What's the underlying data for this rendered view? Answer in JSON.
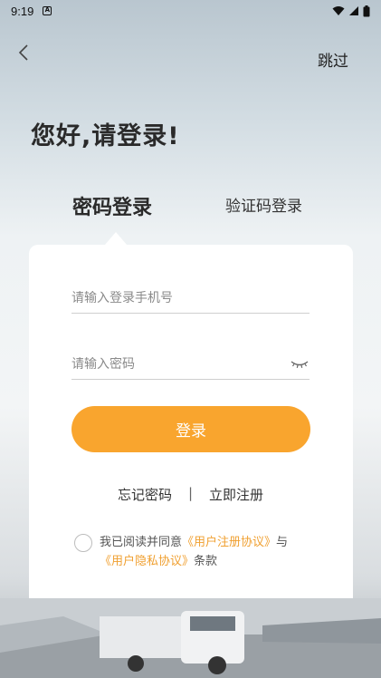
{
  "status_bar": {
    "time": "9:19",
    "app_indicator": "A"
  },
  "nav": {
    "skip_label": "跳过"
  },
  "greeting": "您好,请登录!",
  "tabs": [
    {
      "label": "密码登录",
      "active": true
    },
    {
      "label": "验证码登录",
      "active": false
    }
  ],
  "form": {
    "phone_placeholder": "请输入登录手机号",
    "phone_value": "",
    "password_placeholder": "请输入密码",
    "password_value": "",
    "login_label": "登录"
  },
  "links": {
    "forgot": "忘记密码",
    "separator": "|",
    "register": "立即注册"
  },
  "agreement": {
    "prefix": "我已阅读并同意",
    "user_agreement": "《用户注册协议》",
    "conjunction": "与",
    "privacy_policy": "《用户隐私协议》",
    "suffix": "条款",
    "checked": false
  },
  "colors": {
    "accent": "#f9a52e",
    "link": "#f0a031",
    "card": "#ffffff"
  }
}
